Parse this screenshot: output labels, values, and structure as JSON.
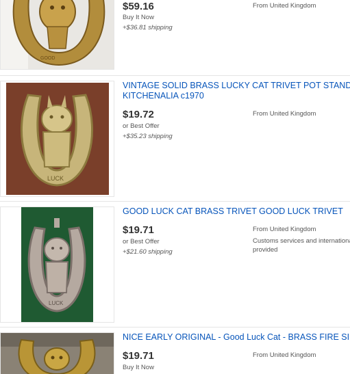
{
  "listings": [
    {
      "title": "",
      "price": "$59.16",
      "format": "Buy It Now",
      "shipping": "+$36.81 shipping",
      "location": "From United Kingdom"
    },
    {
      "title_line1": "VINTAGE SOLID BRASS LUCKY CAT TRIVET POT STAND GOOD LUCK",
      "title_line2": "KITCHENALIA c1970",
      "price": "$19.72",
      "format": "or Best Offer",
      "shipping": "+$35.23 shipping",
      "location": "From United Kingdom"
    },
    {
      "title": "GOOD LUCK CAT BRASS TRIVET GOOD LUCK TRIVET",
      "price": "$19.71",
      "format": "or Best Offer",
      "shipping": "+$21.60 shipping",
      "location": "From United Kingdom",
      "customs_line1": "Customs services and international tracking",
      "customs_line2": "provided"
    },
    {
      "title": "NICE EARLY ORIGINAL - Good Luck Cat - BRASS FIRE SIDE TRIVET",
      "price": "$19.71",
      "format": "Buy It Now",
      "location": "From United Kingdom"
    }
  ],
  "colors": {
    "link": "#0654ba",
    "price": "#333333",
    "secondary_text": "#555555",
    "divider": "#e5e5e5"
  },
  "icons": {
    "thumbnail_1": "brass-cat-horseshoe-trivet-photo",
    "thumbnail_2": "brass-cat-horseshoe-trivet-photo",
    "thumbnail_3": "silver-cat-horseshoe-trivet-on-green-photo",
    "thumbnail_4": "brass-cat-trivet-photo"
  }
}
